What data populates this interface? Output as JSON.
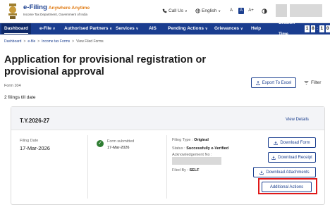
{
  "header": {
    "brand_title": "e-Filing",
    "brand_tagline": "Anywhere Anytime",
    "brand_sub": "Income Tax Department, Government of India",
    "call_us": "Call Us",
    "language": "English",
    "font_small": "A",
    "font_normal": "A",
    "font_large": "A+"
  },
  "nav": {
    "items": [
      "Dashboard",
      "e-File",
      "Authorised Partners",
      "Services",
      "AIS",
      "Pending Actions",
      "Grievances",
      "Help"
    ],
    "session_label": "Session Time",
    "session_digits": [
      "1",
      "8",
      "1",
      "0"
    ],
    "session_colon": ":"
  },
  "breadcrumb": [
    "Dashboard",
    "e-file",
    "Income tax Forms",
    "View Filed Forms"
  ],
  "breadcrumb_sep": ">",
  "page": {
    "title": "Application for provisional registration or provisional approval",
    "form_number": "Form 104",
    "filings_count": "2 filings till date",
    "export_label": "Export To Excel",
    "filter_label": "Filter"
  },
  "card": {
    "year": "T.Y.2026-27",
    "view_details": "View Details",
    "filing_date_label": "Filing Date",
    "filing_date": "17-Mar-2026",
    "submitted_label": "Form submitted",
    "submitted_date": "17-Mar-2026",
    "filing_type_label": "Filing Type :",
    "filing_type": "Original",
    "status_label": "Status :",
    "status": "Successfully e-Verified",
    "ack_label": "Acknowledgement No :",
    "filed_by_label": "Filed By :",
    "filed_by": "SELF",
    "buttons": {
      "download_form": "Download Form",
      "download_receipt": "Download Receipt",
      "download_attachments": "Download Attachments",
      "additional_actions": "Additional Actions"
    }
  },
  "colors": {
    "nav_bg": "#1a3d8f",
    "accent": "#1b3f8f",
    "success": "#2e7d32",
    "highlight": "#e01919"
  }
}
